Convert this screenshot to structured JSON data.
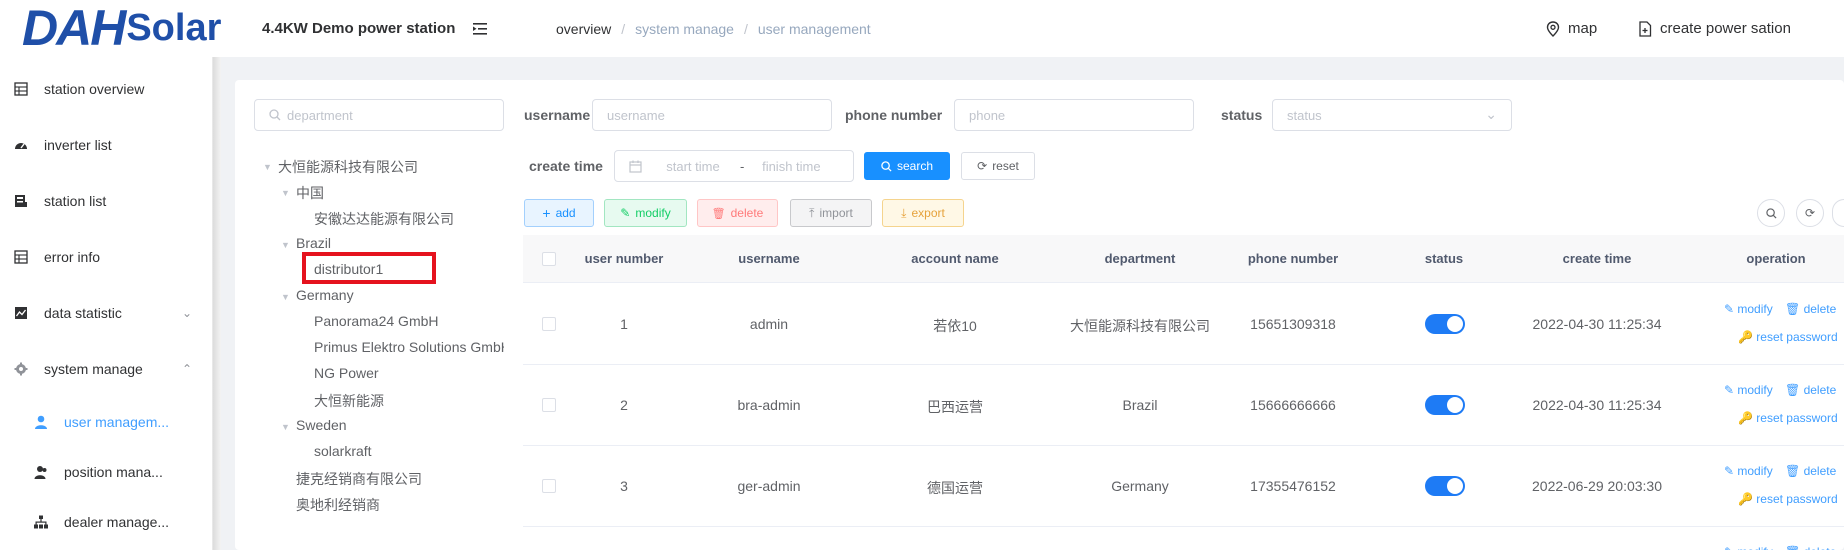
{
  "header": {
    "logo_main": "DAH",
    "logo_sub": "Solar",
    "station_title": "4.4KW Demo power station",
    "breadcrumb": [
      "overview",
      "system manage",
      "user management"
    ],
    "map_label": "map",
    "create_label": "create power sation"
  },
  "sidebar": {
    "items": [
      {
        "label": "station overview",
        "icon": "grid-icon"
      },
      {
        "label": "inverter list",
        "icon": "dashboard-icon"
      },
      {
        "label": "station list",
        "icon": "station-icon"
      },
      {
        "label": "error info",
        "icon": "grid-icon"
      },
      {
        "label": "data statistic",
        "icon": "chart-icon"
      },
      {
        "label": "system manage",
        "icon": "gear-icon"
      }
    ],
    "sub_items": [
      {
        "label": "user managem...",
        "icon": "user-icon"
      },
      {
        "label": "position mana...",
        "icon": "users-icon"
      },
      {
        "label": "dealer manage...",
        "icon": "org-icon"
      }
    ]
  },
  "filters": {
    "department_placeholder": "department",
    "username_label": "username",
    "username_placeholder": "username",
    "phone_label": "phone number",
    "phone_placeholder": "phone",
    "status_label": "status",
    "status_placeholder": "status",
    "create_time_label": "create time",
    "start_placeholder": "start time",
    "range_sep": "-",
    "finish_placeholder": "finish time",
    "search_label": "search",
    "reset_label": "reset"
  },
  "tree": {
    "root": "大恒能源科技有限公司",
    "china": "中国",
    "china_child": "安徽达达能源有限公司",
    "brazil": "Brazil",
    "brazil_child": "distributor1",
    "germany": "Germany",
    "germany_children": [
      "Panorama24 GmbH",
      "Primus Elektro Solutions GmbH",
      "NG Power",
      "大恒新能源"
    ],
    "sweden": "Sweden",
    "sweden_child": "solarkraft",
    "other1": "捷克经销商有限公司",
    "other2": "奥地利经销商"
  },
  "actions": {
    "add": "add",
    "modify": "modify",
    "delete": "delete",
    "import": "import",
    "export": "export"
  },
  "table": {
    "columns": [
      "user number",
      "username",
      "account name",
      "department",
      "phone number",
      "status",
      "create time",
      "operation"
    ],
    "rows": [
      {
        "num": "1",
        "username": "admin",
        "account": "若依10",
        "department": "大恒能源科技有限公司",
        "phone": "15651309318",
        "time": "2022-04-30 11:25:34"
      },
      {
        "num": "2",
        "username": "bra-admin",
        "account": "巴西运营",
        "department": "Brazil",
        "phone": "15666666666",
        "time": "2022-04-30 11:25:34"
      },
      {
        "num": "3",
        "username": "ger-admin",
        "account": "德国运营",
        "department": "Germany",
        "phone": "17355476152",
        "time": "2022-06-29 20:03:30"
      }
    ],
    "op_modify": "modify",
    "op_delete": "delete",
    "op_reset": "reset password"
  }
}
